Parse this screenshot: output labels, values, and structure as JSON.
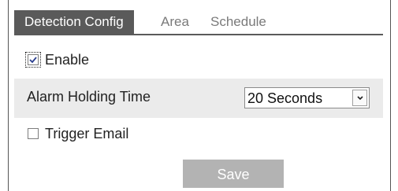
{
  "tabs": [
    {
      "label": "Detection Config",
      "active": true
    },
    {
      "label": "Area",
      "active": false
    },
    {
      "label": "Schedule",
      "active": false
    }
  ],
  "enable": {
    "label": "Enable",
    "checked": true
  },
  "alarm_holding_time": {
    "label": "Alarm Holding Time",
    "selected": "20 Seconds"
  },
  "trigger_email": {
    "label": "Trigger Email",
    "checked": false
  },
  "save_label": "Save",
  "colors": {
    "tab_active_bg": "#5a5a5a",
    "alarm_row_bg": "#ebebeb",
    "save_bg": "#b3b3b3"
  }
}
